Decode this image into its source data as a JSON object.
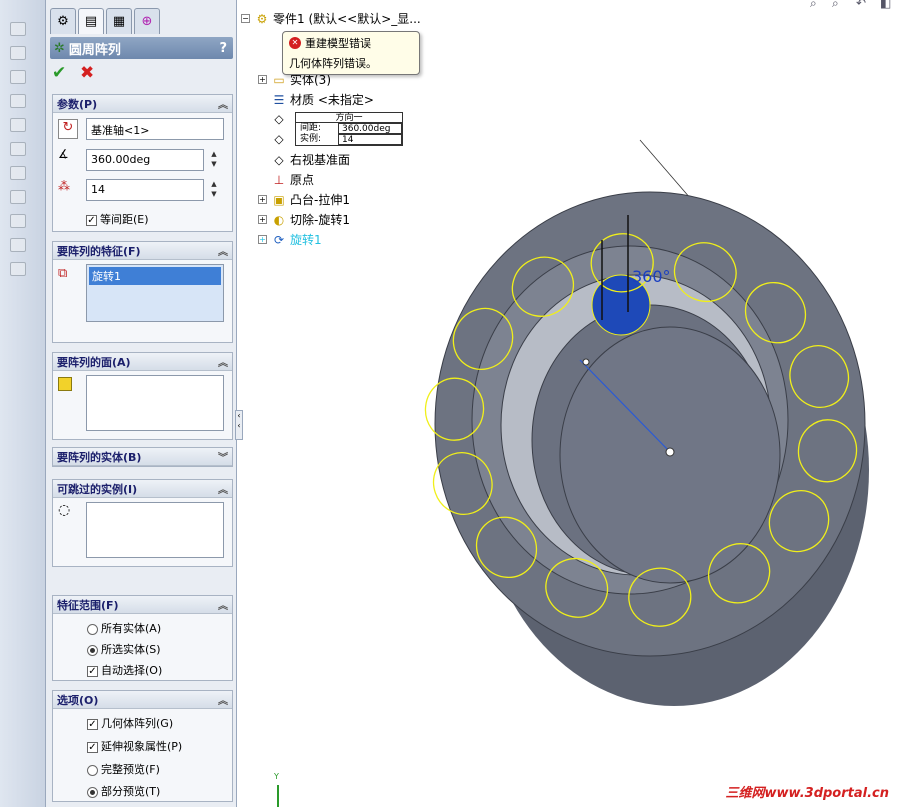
{
  "property_manager": {
    "title": "圆周阵列",
    "help": "?",
    "ok_icon": "checkmark-icon",
    "cancel_icon": "x-icon",
    "parameters": {
      "header": "参数(P)",
      "axis": "基准轴<1>",
      "angle": "360.00deg",
      "instances": "14",
      "equal_spacing": "等间距(E)",
      "equal_spacing_checked": true
    },
    "features_to_pattern": {
      "header": "要阵列的特征(F)",
      "items": [
        "旋转1"
      ]
    },
    "faces_to_pattern": {
      "header": "要阵列的面(A)"
    },
    "bodies_to_pattern": {
      "header": "要阵列的实体(B)"
    },
    "skip_instances": {
      "header": "可跳过的实例(I)"
    },
    "feature_scope": {
      "header": "特征范围(F)",
      "all_bodies": "所有实体(A)",
      "selected_bodies": "所选实体(S)",
      "auto_select": "自动选择(O)",
      "selected": "selected_bodies",
      "auto_select_checked": true
    },
    "options": {
      "header": "选项(O)",
      "geometry_pattern": "几何体阵列(G)",
      "propagate_visual": "延伸视象属性(P)",
      "full_preview": "完整预览(F)",
      "partial_preview": "部分预览(T)",
      "geometry_pattern_checked": true,
      "propagate_visual_checked": true,
      "preview": "partial"
    }
  },
  "tree": {
    "root": "零件1 (默认<<默认>_显...",
    "solid_bodies": "实体(3)",
    "material": "材质 <未指定>",
    "right_plane": "右视基准面",
    "origin": "原点",
    "boss_extrude": "凸台-拉伸1",
    "cut_revolve": "切除-旋转1",
    "revolve": "旋转1"
  },
  "tooltip": {
    "title": "重建模型错误",
    "message": "几何体阵列错误。"
  },
  "callout": {
    "header": "方向一",
    "spacing_label": "间距:",
    "spacing_value": "360.00deg",
    "instances_label": "实例:",
    "instances_value": "14"
  },
  "viewport": {
    "angle_label": "360°",
    "axis_label": "Y"
  },
  "watermark": "三维网www.3dportal.cn",
  "colors": {
    "accent": "#6e88ad",
    "error": "#d42020",
    "preview": "#f0ef1a",
    "model": "#6b7280"
  }
}
